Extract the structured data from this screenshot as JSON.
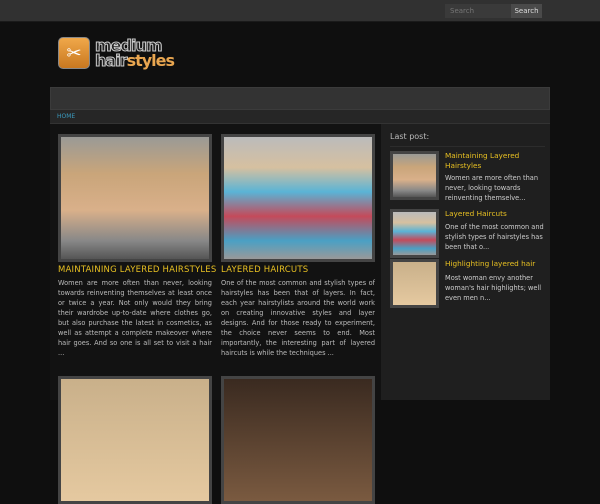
{
  "search": {
    "placeholder": "Search",
    "button": "Search"
  },
  "logo": {
    "line1": "medium",
    "line2a": "hair",
    "line2b": "styles"
  },
  "breadcrumb": {
    "home": "HOME"
  },
  "posts": [
    {
      "title": "MAINTAINING LAYERED HAIRSTYLES",
      "excerpt": "Women are more often than never, looking towards reinventing themselves at least once or twice a year. Not only would they bring their wardrobe up-to-date where clothes go, but also purchase the latest in cosmetics, as well as attempt a complete makeover where hair goes. And so one is all set to visit a hair ..."
    },
    {
      "title": "LAYERED HAIRCUTS",
      "excerpt": "One of the most common and stylish types of hairstyles has been that of layers. In fact, each year hairstylists around the world work on creating innovative styles and layer designs. And for those ready to experiment, the choice never seems to end. Most importantly, the interesting part of layered haircuts is while the techniques ..."
    }
  ],
  "sidebar": {
    "heading": "Last post:",
    "items": [
      {
        "title": "Maintaining Layered Hairstyles",
        "excerpt": "Women are more often than never, looking towards reinventing themselve..."
      },
      {
        "title": "Layered Haircuts",
        "excerpt": "One of the most common and stylish types of hairstyles has been that o..."
      },
      {
        "title": "Highlighting layered hair",
        "excerpt": "Most woman envy another woman's hair highlights; well even men n..."
      }
    ]
  }
}
